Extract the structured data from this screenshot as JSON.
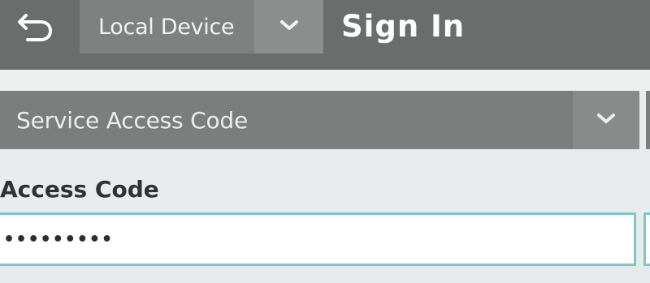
{
  "header": {
    "back_icon": "back-arrow-icon",
    "device_select": {
      "selected": "Local Device",
      "icon": "chevron-down-icon"
    },
    "title": "Sign In"
  },
  "signin_method": {
    "selected": "Service Access Code",
    "icon": "chevron-down-icon"
  },
  "access_code": {
    "label": "Access Code",
    "value": "•••••••••"
  },
  "colors": {
    "header_bg": "#6b6d6d",
    "dropdown_bg": "#7c7e7e",
    "input_border": "#7ec6cc",
    "page_bg": "#e9ecec"
  }
}
